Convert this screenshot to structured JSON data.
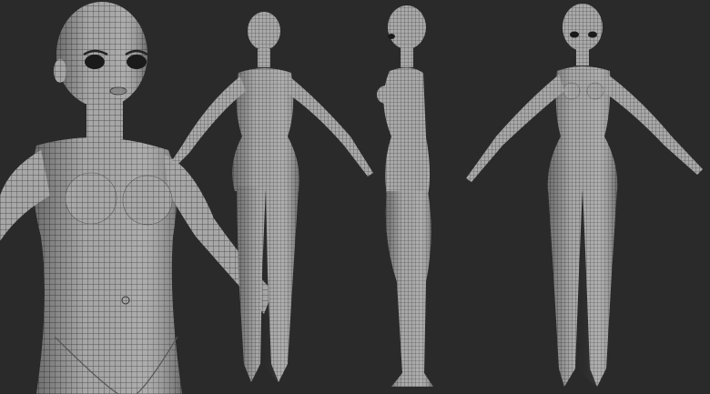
{
  "scene": {
    "background_color": "#2a2a2a",
    "mesh_fill_color": "#a9a9a9",
    "mesh_shadow_color": "#6e6e6e",
    "wire_color": "#2b2b2b",
    "views": [
      {
        "name": "front-closeup-view"
      },
      {
        "name": "back-view"
      },
      {
        "name": "side-view"
      },
      {
        "name": "front-full-view"
      }
    ]
  }
}
